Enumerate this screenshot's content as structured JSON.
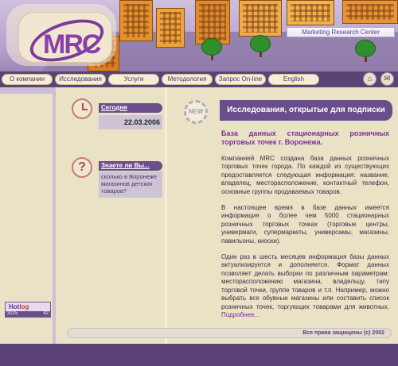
{
  "header": {
    "logo_text": "MRC",
    "slogan": "Marketing Research Center"
  },
  "nav": {
    "items": [
      {
        "label": "О компании"
      },
      {
        "label": "Исследования"
      },
      {
        "label": "Услуги"
      },
      {
        "label": "Методология"
      },
      {
        "label": "Запрос On-line"
      },
      {
        "label": "English"
      }
    ],
    "icons": [
      "home-icon",
      "mail-icon"
    ]
  },
  "date_widget": {
    "heading": "Сегодня",
    "date": "22.03.2006"
  },
  "tip_widget": {
    "heading": "Знаете ли Вы...",
    "text": "сколько в Воронеже магазинов детских товаров?"
  },
  "hotlog": {
    "brand_a": "Hot",
    "brand_b": "log",
    "count": "3215",
    "sub": "42"
  },
  "main": {
    "badge": "NEW",
    "title": "Исследования, открытые для подписки",
    "subheading": "База данных стационарных розничных торговых точек г. Воронежа.",
    "paragraphs": [
      "Компанией MRC создана база данных розничных торговых точек города. По каждой из существующих предоставляется следующая информация: название, владелец, месторасположение, контактный телефон, основные группы продаваемых товаров.",
      "В настоящее время в базе данных имеется информация о более чем 5000 стационарных розничных торговых точках (торговые центры, универмаги, супермаркеты, универсамы, магазины, павильоны, киоски).",
      "Один раз в шесть месяцев информация базы данных актуализируется и дополняется. Формат данных позволяет делать выборки по различным параметрам: месторасположению магазина, владельцу, типу торговой точки, группе товаров и т.п. Например, можно выбрать все обувные магазины или составить список розничных точек, торгующих товарами для животных."
    ],
    "more_link": "Подробнее..."
  },
  "footer": {
    "copyright": "Все права защищены (с) 2002"
  },
  "colors": {
    "accent": "#6a4d8b",
    "nav_bar": "#5b4377",
    "background": "#e9e2c4",
    "highlight": "#7a2f9e"
  }
}
